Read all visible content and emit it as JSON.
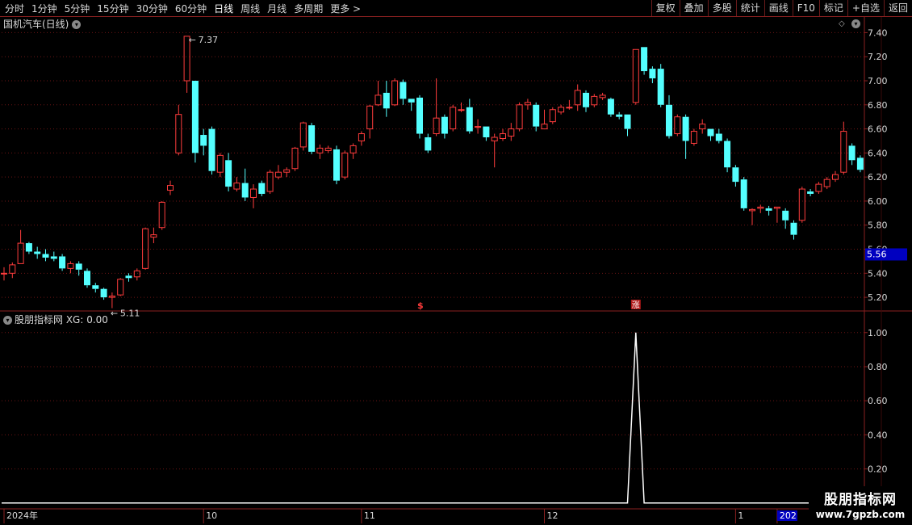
{
  "toolbar": {
    "periods": [
      "分时",
      "1分钟",
      "5分钟",
      "15分钟",
      "30分钟",
      "60分钟",
      "日线",
      "周线",
      "月线",
      "多周期",
      "更多 >"
    ],
    "active_index": 6,
    "actions": [
      "复权",
      "叠加",
      "多股",
      "统计",
      "画线",
      "F10",
      "标记",
      "+自选",
      "返回"
    ]
  },
  "main_title": "国机汽车(日线)",
  "indicator_title": "股朋指标网 XG: 0.00",
  "price_badge": "5.56",
  "annotations": {
    "high_label": "7.37",
    "low_label": "5.11"
  },
  "signal_markers": [
    "$",
    "涨"
  ],
  "watermark": {
    "name": "股朋指标网",
    "url": "www.7gpzb.com"
  },
  "colors": {
    "up": "#ff3c3c",
    "down": "#54ffff",
    "grid": "#6b1414",
    "axis": "#8a2020",
    "line": "#ffffff",
    "badge_bg": "#0000c0"
  },
  "chart_data": [
    {
      "type": "candlestick",
      "x_labels": [
        "2024年",
        "10",
        "11",
        "12",
        "1",
        "202"
      ],
      "y_ticks": [
        5.2,
        5.4,
        5.6,
        5.8,
        6.0,
        6.2,
        6.4,
        6.6,
        6.8,
        7.0,
        7.2,
        7.4
      ],
      "ylim": [
        5.1,
        7.47
      ],
      "grid": true,
      "candles": [
        [
          5.4,
          5.4,
          5.34,
          5.45
        ],
        [
          5.4,
          5.47,
          5.36,
          5.49
        ],
        [
          5.48,
          5.65,
          5.48,
          5.76
        ],
        [
          5.65,
          5.58,
          5.56,
          5.66
        ],
        [
          5.58,
          5.56,
          5.52,
          5.62
        ],
        [
          5.56,
          5.53,
          5.5,
          5.6
        ],
        [
          5.54,
          5.52,
          5.5,
          5.58
        ],
        [
          5.54,
          5.44,
          5.42,
          5.56
        ],
        [
          5.44,
          5.48,
          5.4,
          5.5
        ],
        [
          5.48,
          5.43,
          5.38,
          5.5
        ],
        [
          5.42,
          5.3,
          5.28,
          5.44
        ],
        [
          5.3,
          5.27,
          5.24,
          5.32
        ],
        [
          5.27,
          5.2,
          5.18,
          5.28
        ],
        [
          5.2,
          5.21,
          5.11,
          5.24
        ],
        [
          5.22,
          5.35,
          5.21,
          5.36
        ],
        [
          5.38,
          5.36,
          5.33,
          5.4
        ],
        [
          5.37,
          5.42,
          5.34,
          5.44
        ],
        [
          5.44,
          5.77,
          5.43,
          5.78
        ],
        [
          5.7,
          5.72,
          5.65,
          5.78
        ],
        [
          5.78,
          5.99,
          5.76,
          6.0
        ],
        [
          6.09,
          6.13,
          6.05,
          6.17
        ],
        [
          6.4,
          6.72,
          6.38,
          6.8
        ],
        [
          7.0,
          7.37,
          6.9,
          7.37
        ],
        [
          7.0,
          6.4,
          6.32,
          7.0
        ],
        [
          6.55,
          6.46,
          6.38,
          6.6
        ],
        [
          6.6,
          6.25,
          6.22,
          6.62
        ],
        [
          6.24,
          6.38,
          6.2,
          6.4
        ],
        [
          6.34,
          6.12,
          6.08,
          6.4
        ],
        [
          6.1,
          6.15,
          6.08,
          6.2
        ],
        [
          6.15,
          6.03,
          6.0,
          6.27
        ],
        [
          6.03,
          6.1,
          5.94,
          6.14
        ],
        [
          6.15,
          6.06,
          6.04,
          6.17
        ],
        [
          6.08,
          6.24,
          6.06,
          6.26
        ],
        [
          6.2,
          6.24,
          6.18,
          6.3
        ],
        [
          6.24,
          6.26,
          6.2,
          6.28
        ],
        [
          6.27,
          6.44,
          6.25,
          6.45
        ],
        [
          6.45,
          6.65,
          6.42,
          6.66
        ],
        [
          6.63,
          6.41,
          6.39,
          6.65
        ],
        [
          6.4,
          6.44,
          6.35,
          6.47
        ],
        [
          6.42,
          6.44,
          6.4,
          6.46
        ],
        [
          6.43,
          6.17,
          6.14,
          6.46
        ],
        [
          6.2,
          6.4,
          6.18,
          6.42
        ],
        [
          6.4,
          6.46,
          6.35,
          6.48
        ],
        [
          6.5,
          6.56,
          6.46,
          6.58
        ],
        [
          6.6,
          6.79,
          6.52,
          6.8
        ],
        [
          6.8,
          6.88,
          6.79,
          7.0
        ],
        [
          6.9,
          6.77,
          6.7,
          7.0
        ],
        [
          6.8,
          7.0,
          6.79,
          7.02
        ],
        [
          6.99,
          6.85,
          6.8,
          7.01
        ],
        [
          6.85,
          6.82,
          6.75,
          6.85
        ],
        [
          6.86,
          6.56,
          6.52,
          6.88
        ],
        [
          6.53,
          6.42,
          6.4,
          6.56
        ],
        [
          6.56,
          6.69,
          6.54,
          7.02
        ],
        [
          6.7,
          6.56,
          6.52,
          6.72
        ],
        [
          6.6,
          6.78,
          6.58,
          6.8
        ],
        [
          6.76,
          6.76,
          6.74,
          6.82
        ],
        [
          6.78,
          6.58,
          6.56,
          6.85
        ],
        [
          6.62,
          6.62,
          6.56,
          6.68
        ],
        [
          6.62,
          6.53,
          6.5,
          6.62
        ],
        [
          6.5,
          6.53,
          6.28,
          6.56
        ],
        [
          6.52,
          6.56,
          6.5,
          6.6
        ],
        [
          6.54,
          6.6,
          6.5,
          6.65
        ],
        [
          6.6,
          6.8,
          6.58,
          6.82
        ],
        [
          6.8,
          6.82,
          6.76,
          6.85
        ],
        [
          6.8,
          6.62,
          6.58,
          6.82
        ],
        [
          6.6,
          6.64,
          6.6,
          6.76
        ],
        [
          6.66,
          6.76,
          6.64,
          6.78
        ],
        [
          6.74,
          6.78,
          6.72,
          6.8
        ],
        [
          6.78,
          6.78,
          6.76,
          6.84
        ],
        [
          6.8,
          6.92,
          6.75,
          6.97
        ],
        [
          6.9,
          6.78,
          6.74,
          6.92
        ],
        [
          6.8,
          6.87,
          6.78,
          6.89
        ],
        [
          6.86,
          6.88,
          6.84,
          6.9
        ],
        [
          6.85,
          6.72,
          6.7,
          6.86
        ],
        [
          6.72,
          6.7,
          6.68,
          6.74
        ],
        [
          6.72,
          6.6,
          6.54,
          6.72
        ],
        [
          6.82,
          7.26,
          6.8,
          7.26
        ],
        [
          7.28,
          7.08,
          7.05,
          7.28
        ],
        [
          7.1,
          7.02,
          6.98,
          7.12
        ],
        [
          7.1,
          6.8,
          6.78,
          7.14
        ],
        [
          6.8,
          6.54,
          6.52,
          6.88
        ],
        [
          6.56,
          6.7,
          6.54,
          6.72
        ],
        [
          6.7,
          6.5,
          6.35,
          6.72
        ],
        [
          6.48,
          6.58,
          6.46,
          6.6
        ],
        [
          6.6,
          6.64,
          6.56,
          6.68
        ],
        [
          6.6,
          6.54,
          6.5,
          6.6
        ],
        [
          6.56,
          6.5,
          6.48,
          6.6
        ],
        [
          6.5,
          6.28,
          6.24,
          6.52
        ],
        [
          6.28,
          6.16,
          6.12,
          6.3
        ],
        [
          6.18,
          5.94,
          5.92,
          6.2
        ],
        [
          5.92,
          5.93,
          5.8,
          5.94
        ],
        [
          5.94,
          5.95,
          5.9,
          5.97
        ],
        [
          5.94,
          5.92,
          5.88,
          5.96
        ],
        [
          5.94,
          5.95,
          5.82,
          5.95
        ],
        [
          5.92,
          5.84,
          5.77,
          5.94
        ],
        [
          5.82,
          5.72,
          5.68,
          5.84
        ],
        [
          5.84,
          6.1,
          5.82,
          6.12
        ],
        [
          6.08,
          6.06,
          6.04,
          6.1
        ],
        [
          6.08,
          6.14,
          6.06,
          6.16
        ],
        [
          6.12,
          6.18,
          6.1,
          6.2
        ],
        [
          6.18,
          6.22,
          6.16,
          6.25
        ],
        [
          6.24,
          6.58,
          6.22,
          6.66
        ],
        [
          6.46,
          6.34,
          6.3,
          6.48
        ],
        [
          6.36,
          6.26,
          6.24,
          6.38
        ]
      ]
    },
    {
      "type": "line",
      "name": "XG",
      "y_ticks": [
        0.2,
        0.4,
        0.6,
        0.8,
        1.0
      ],
      "ylim": [
        -0.02,
        1.07
      ],
      "grid": true,
      "signal_index": 76,
      "signal_value": 1.0
    }
  ]
}
